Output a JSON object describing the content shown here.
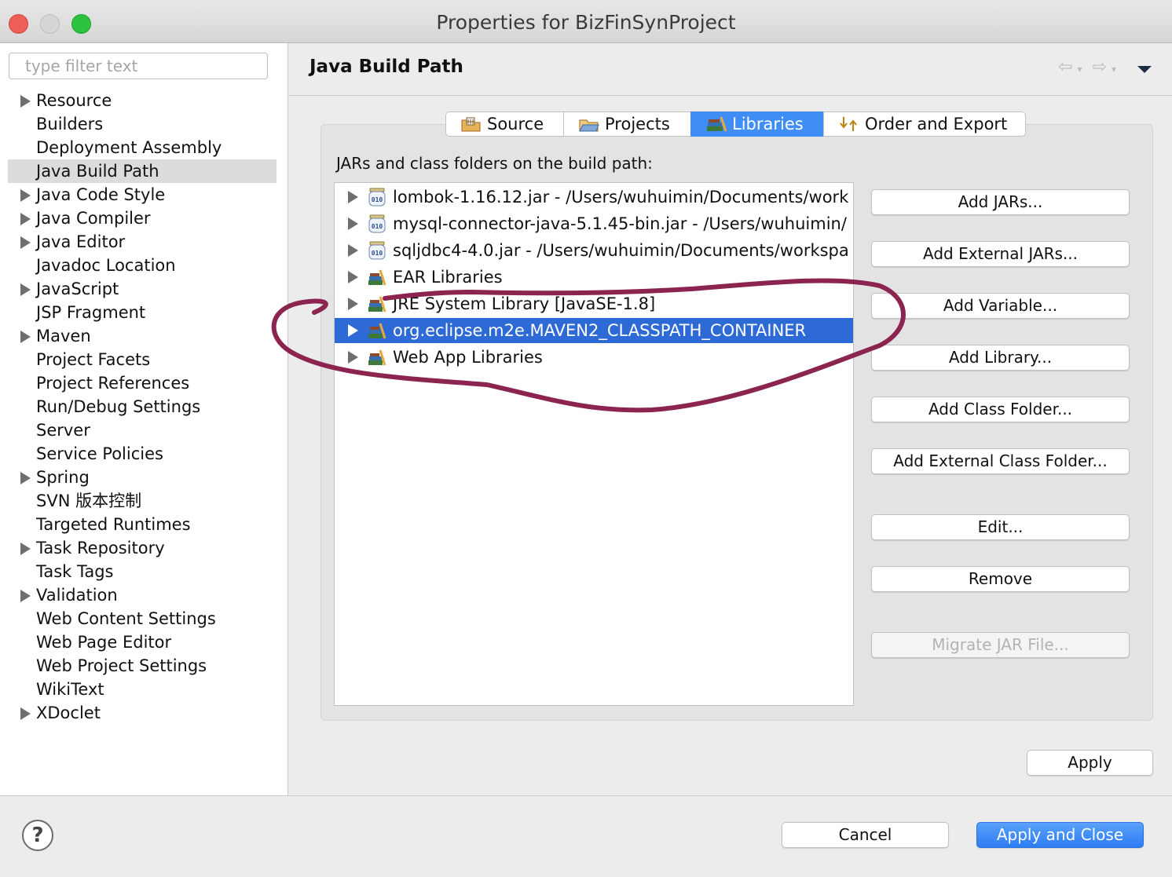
{
  "window": {
    "title": "Properties for BizFinSynProject"
  },
  "sidebar": {
    "filter_placeholder": "type filter text",
    "items": [
      {
        "label": "Resource",
        "expandable": true
      },
      {
        "label": "Builders",
        "expandable": false
      },
      {
        "label": "Deployment Assembly",
        "expandable": false
      },
      {
        "label": "Java Build Path",
        "expandable": false,
        "selected": true
      },
      {
        "label": "Java Code Style",
        "expandable": true
      },
      {
        "label": "Java Compiler",
        "expandable": true
      },
      {
        "label": "Java Editor",
        "expandable": true
      },
      {
        "label": "Javadoc Location",
        "expandable": false
      },
      {
        "label": "JavaScript",
        "expandable": true
      },
      {
        "label": "JSP Fragment",
        "expandable": false
      },
      {
        "label": "Maven",
        "expandable": true
      },
      {
        "label": "Project Facets",
        "expandable": false
      },
      {
        "label": "Project References",
        "expandable": false
      },
      {
        "label": "Run/Debug Settings",
        "expandable": false
      },
      {
        "label": "Server",
        "expandable": false
      },
      {
        "label": "Service Policies",
        "expandable": false
      },
      {
        "label": "Spring",
        "expandable": true
      },
      {
        "label": "SVN 版本控制",
        "expandable": false
      },
      {
        "label": "Targeted Runtimes",
        "expandable": false
      },
      {
        "label": "Task Repository",
        "expandable": true
      },
      {
        "label": "Task Tags",
        "expandable": false
      },
      {
        "label": "Validation",
        "expandable": true
      },
      {
        "label": "Web Content Settings",
        "expandable": false
      },
      {
        "label": "Web Page Editor",
        "expandable": false
      },
      {
        "label": "Web Project Settings",
        "expandable": false
      },
      {
        "label": "WikiText",
        "expandable": false
      },
      {
        "label": "XDoclet",
        "expandable": true
      }
    ]
  },
  "page": {
    "title": "Java Build Path",
    "tabs": [
      {
        "label": "Source",
        "icon": "source-folder-icon"
      },
      {
        "label": "Projects",
        "icon": "projects-folder-icon"
      },
      {
        "label": "Libraries",
        "icon": "libraries-icon",
        "active": true
      },
      {
        "label": "Order and Export",
        "icon": "order-export-icon"
      }
    ],
    "section_label": "JARs and class folders on the build path:",
    "entries": [
      {
        "label": "lombok-1.16.12.jar - /Users/wuhuimin/Documents/work",
        "icon": "jar-icon"
      },
      {
        "label": "mysql-connector-java-5.1.45-bin.jar - /Users/wuhuimin/",
        "icon": "jar-icon"
      },
      {
        "label": "sqljdbc4-4.0.jar - /Users/wuhuimin/Documents/workspa",
        "icon": "jar-icon"
      },
      {
        "label": "EAR Libraries",
        "icon": "library-icon"
      },
      {
        "label": "JRE System Library [JavaSE-1.8]",
        "icon": "library-icon"
      },
      {
        "label": "org.eclipse.m2e.MAVEN2_CLASSPATH_CONTAINER",
        "icon": "library-icon",
        "selected": true
      },
      {
        "label": "Web App Libraries",
        "icon": "library-icon"
      }
    ],
    "buttons": {
      "add_jars": "Add JARs...",
      "add_external_jars": "Add External JARs...",
      "add_variable": "Add Variable...",
      "add_library": "Add Library...",
      "add_class_folder": "Add Class Folder...",
      "add_external_class_folder": "Add External Class Folder...",
      "edit": "Edit...",
      "remove": "Remove",
      "migrate_jar": "Migrate JAR File..."
    },
    "apply": "Apply"
  },
  "footer": {
    "help": "?",
    "cancel": "Cancel",
    "apply_and_close": "Apply and Close"
  },
  "colors": {
    "accent": "#3e8ef6",
    "selection": "#2e6ad6",
    "annotation": "#8b2550"
  }
}
